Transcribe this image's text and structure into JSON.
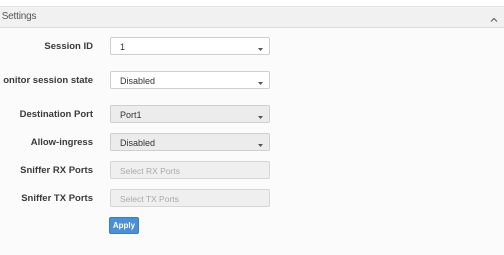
{
  "panel": {
    "title": "r Settings",
    "collapse_icon": "chevron-up-icon"
  },
  "form": {
    "session_id": {
      "label": "Session ID",
      "value": "1"
    },
    "monitor_session_state": {
      "label": "onitor session state",
      "value": "Disabled"
    },
    "destination_port": {
      "label": "Destination Port",
      "value": "Port1"
    },
    "allow_ingress": {
      "label": "Allow-ingress",
      "value": "Disabled"
    },
    "sniffer_rx_ports": {
      "label": "Sniffer RX Ports",
      "placeholder": "Select RX Ports"
    },
    "sniffer_tx_ports": {
      "label": "Sniffer TX Ports",
      "placeholder": "Select TX Ports"
    }
  },
  "apply_label": "Apply",
  "colors": {
    "accent": "#4a90d8",
    "header_bg": "#f1f1f1"
  }
}
